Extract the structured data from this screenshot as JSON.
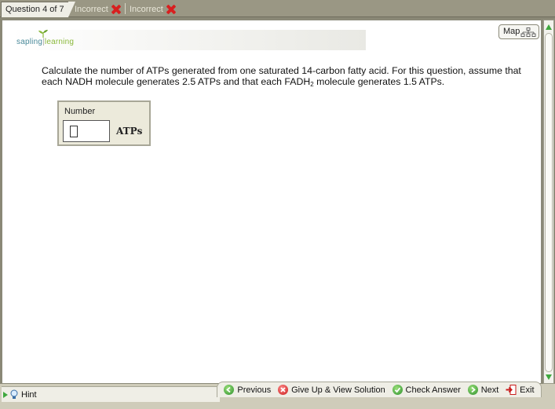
{
  "tabs": {
    "current": "Question 4 of 7",
    "attempts": [
      {
        "label": "Incorrect",
        "icon": "red-x-icon"
      },
      {
        "label": "Incorrect",
        "icon": "red-x-icon"
      }
    ]
  },
  "header": {
    "logo_part1": "sapling",
    "logo_part2": "learning",
    "map_label": "Map"
  },
  "question": {
    "text_before": "Calculate the number of ATPs generated from one saturated 14-carbon fatty acid. For this question, assume that each NADH molecule generates 2.5 ATPs and that each FADH",
    "subscript": "2",
    "text_after": " molecule generates 1.5 ATPs."
  },
  "answer": {
    "label": "Number",
    "value": "",
    "unit": "ATPs"
  },
  "footer": {
    "hint": "Hint",
    "previous": "Previous",
    "give_up": "Give Up & View Solution",
    "check": "Check Answer",
    "next": "Next",
    "exit": "Exit"
  },
  "colors": {
    "accent_green": "#3fa83f",
    "incorrect_red": "#d81f1f",
    "chrome": "#9a9784"
  }
}
